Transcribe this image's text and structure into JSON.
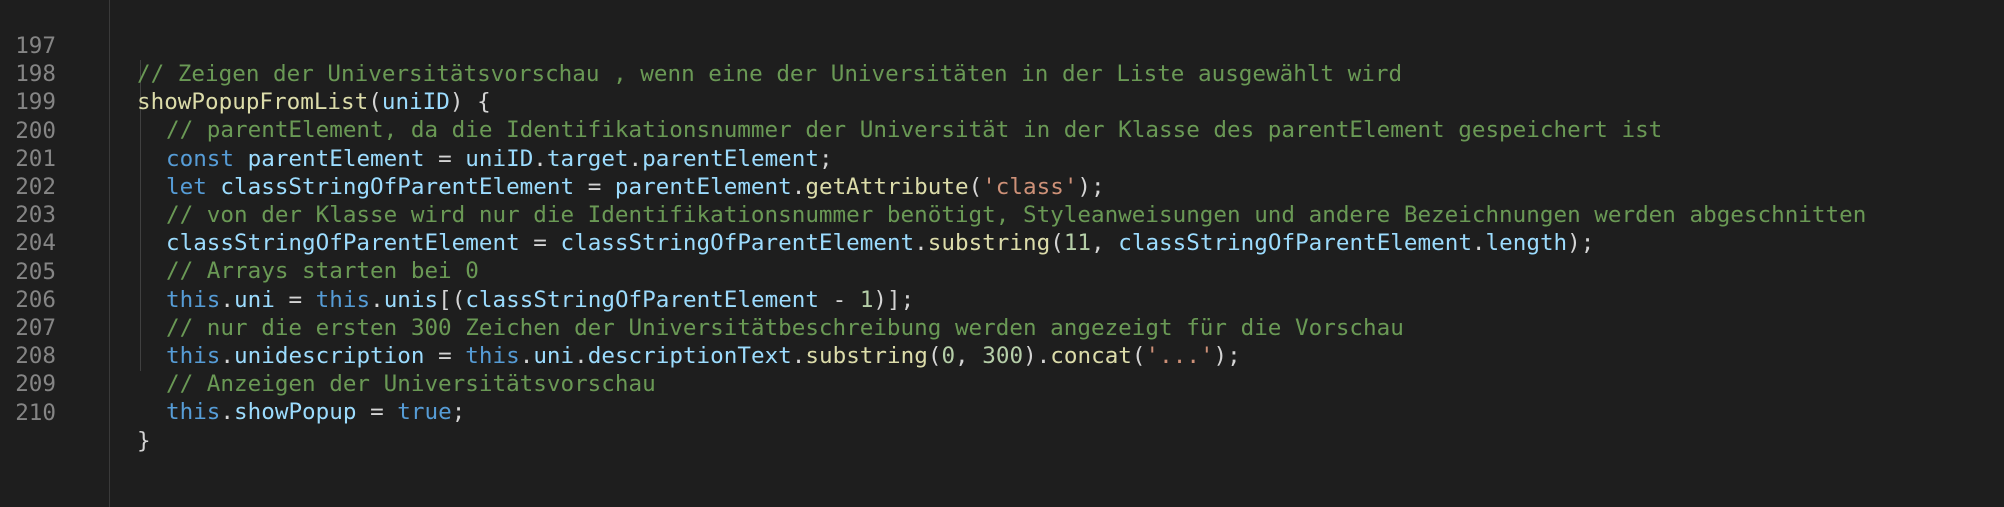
{
  "editor": {
    "lines": [
      {
        "n": "197",
        "tokens": [
          {
            "t": "comment",
            "v": "// Zeigen der Universitätsvorschau , wenn eine der Universitäten in der Liste ausgewählt wird"
          }
        ]
      },
      {
        "n": "198",
        "tokens": [
          {
            "t": "func",
            "v": "showPopupFromList"
          },
          {
            "t": "punc",
            "v": "("
          },
          {
            "t": "var",
            "v": "uniID"
          },
          {
            "t": "punc",
            "v": ") {"
          }
        ]
      },
      {
        "n": "199",
        "tokens": [
          {
            "t": "comment",
            "v": "// parentElement, da die Identifikationsnummer der Universität in der Klasse des parentElement gespeichert ist"
          }
        ]
      },
      {
        "n": "200",
        "tokens": [
          {
            "t": "kw",
            "v": "const"
          },
          {
            "t": "punc",
            "v": " "
          },
          {
            "t": "var",
            "v": "parentElement"
          },
          {
            "t": "punc",
            "v": " = "
          },
          {
            "t": "var",
            "v": "uniID"
          },
          {
            "t": "punc",
            "v": "."
          },
          {
            "t": "var",
            "v": "target"
          },
          {
            "t": "punc",
            "v": "."
          },
          {
            "t": "var",
            "v": "parentElement"
          },
          {
            "t": "punc",
            "v": ";"
          }
        ]
      },
      {
        "n": "201",
        "tokens": [
          {
            "t": "kw",
            "v": "let"
          },
          {
            "t": "punc",
            "v": " "
          },
          {
            "t": "var",
            "v": "classStringOfParentElement"
          },
          {
            "t": "punc",
            "v": " = "
          },
          {
            "t": "var",
            "v": "parentElement"
          },
          {
            "t": "punc",
            "v": "."
          },
          {
            "t": "func",
            "v": "getAttribute"
          },
          {
            "t": "punc",
            "v": "("
          },
          {
            "t": "str",
            "v": "'class'"
          },
          {
            "t": "punc",
            "v": ");"
          }
        ]
      },
      {
        "n": "202",
        "tokens": [
          {
            "t": "comment",
            "v": "// von der Klasse wird nur die Identifikationsnummer benötigt, Styleanweisungen und andere Bezeichnungen werden abgeschnitten"
          }
        ]
      },
      {
        "n": "203",
        "tokens": [
          {
            "t": "var",
            "v": "classStringOfParentElement"
          },
          {
            "t": "punc",
            "v": " = "
          },
          {
            "t": "var",
            "v": "classStringOfParentElement"
          },
          {
            "t": "punc",
            "v": "."
          },
          {
            "t": "func",
            "v": "substring"
          },
          {
            "t": "punc",
            "v": "("
          },
          {
            "t": "num",
            "v": "11"
          },
          {
            "t": "punc",
            "v": ", "
          },
          {
            "t": "var",
            "v": "classStringOfParentElement"
          },
          {
            "t": "punc",
            "v": "."
          },
          {
            "t": "var",
            "v": "length"
          },
          {
            "t": "punc",
            "v": ");"
          }
        ]
      },
      {
        "n": "204",
        "tokens": [
          {
            "t": "comment",
            "v": "// Arrays starten bei 0"
          }
        ]
      },
      {
        "n": "205",
        "tokens": [
          {
            "t": "kw",
            "v": "this"
          },
          {
            "t": "punc",
            "v": "."
          },
          {
            "t": "var",
            "v": "uni"
          },
          {
            "t": "punc",
            "v": " = "
          },
          {
            "t": "kw",
            "v": "this"
          },
          {
            "t": "punc",
            "v": "."
          },
          {
            "t": "var",
            "v": "unis"
          },
          {
            "t": "punc",
            "v": "[("
          },
          {
            "t": "var",
            "v": "classStringOfParentElement"
          },
          {
            "t": "punc",
            "v": " - "
          },
          {
            "t": "num",
            "v": "1"
          },
          {
            "t": "punc",
            "v": ")];"
          }
        ]
      },
      {
        "n": "206",
        "tokens": [
          {
            "t": "comment",
            "v": "// nur die ersten 300 Zeichen der Universitätbeschreibung werden angezeigt für die Vorschau"
          }
        ]
      },
      {
        "n": "207",
        "tokens": [
          {
            "t": "kw",
            "v": "this"
          },
          {
            "t": "punc",
            "v": "."
          },
          {
            "t": "var",
            "v": "unidescription"
          },
          {
            "t": "punc",
            "v": " = "
          },
          {
            "t": "kw",
            "v": "this"
          },
          {
            "t": "punc",
            "v": "."
          },
          {
            "t": "var",
            "v": "uni"
          },
          {
            "t": "punc",
            "v": "."
          },
          {
            "t": "var",
            "v": "descriptionText"
          },
          {
            "t": "punc",
            "v": "."
          },
          {
            "t": "func",
            "v": "substring"
          },
          {
            "t": "punc",
            "v": "("
          },
          {
            "t": "num",
            "v": "0"
          },
          {
            "t": "punc",
            "v": ", "
          },
          {
            "t": "num",
            "v": "300"
          },
          {
            "t": "punc",
            "v": ")."
          },
          {
            "t": "func",
            "v": "concat"
          },
          {
            "t": "punc",
            "v": "("
          },
          {
            "t": "str",
            "v": "'...'"
          },
          {
            "t": "punc",
            "v": ");"
          }
        ]
      },
      {
        "n": "208",
        "tokens": [
          {
            "t": "comment",
            "v": "// Anzeigen der Universitätsvorschau"
          }
        ]
      },
      {
        "n": "209",
        "tokens": [
          {
            "t": "kw",
            "v": "this"
          },
          {
            "t": "punc",
            "v": "."
          },
          {
            "t": "var",
            "v": "showPopup"
          },
          {
            "t": "punc",
            "v": " = "
          },
          {
            "t": "kw",
            "v": "true"
          },
          {
            "t": "punc",
            "v": ";"
          }
        ]
      },
      {
        "n": "210",
        "tokens": [
          {
            "t": "punc",
            "v": "}"
          }
        ]
      }
    ]
  },
  "colors": {
    "background": "#1e1e1e",
    "line_number": "#858585",
    "comment": "#6a9955",
    "function": "#dcdcaa",
    "variable": "#9cdcfe",
    "keyword": "#569cd6",
    "string": "#ce9178",
    "number": "#b5cea8",
    "punctuation": "#d4d4d4"
  }
}
